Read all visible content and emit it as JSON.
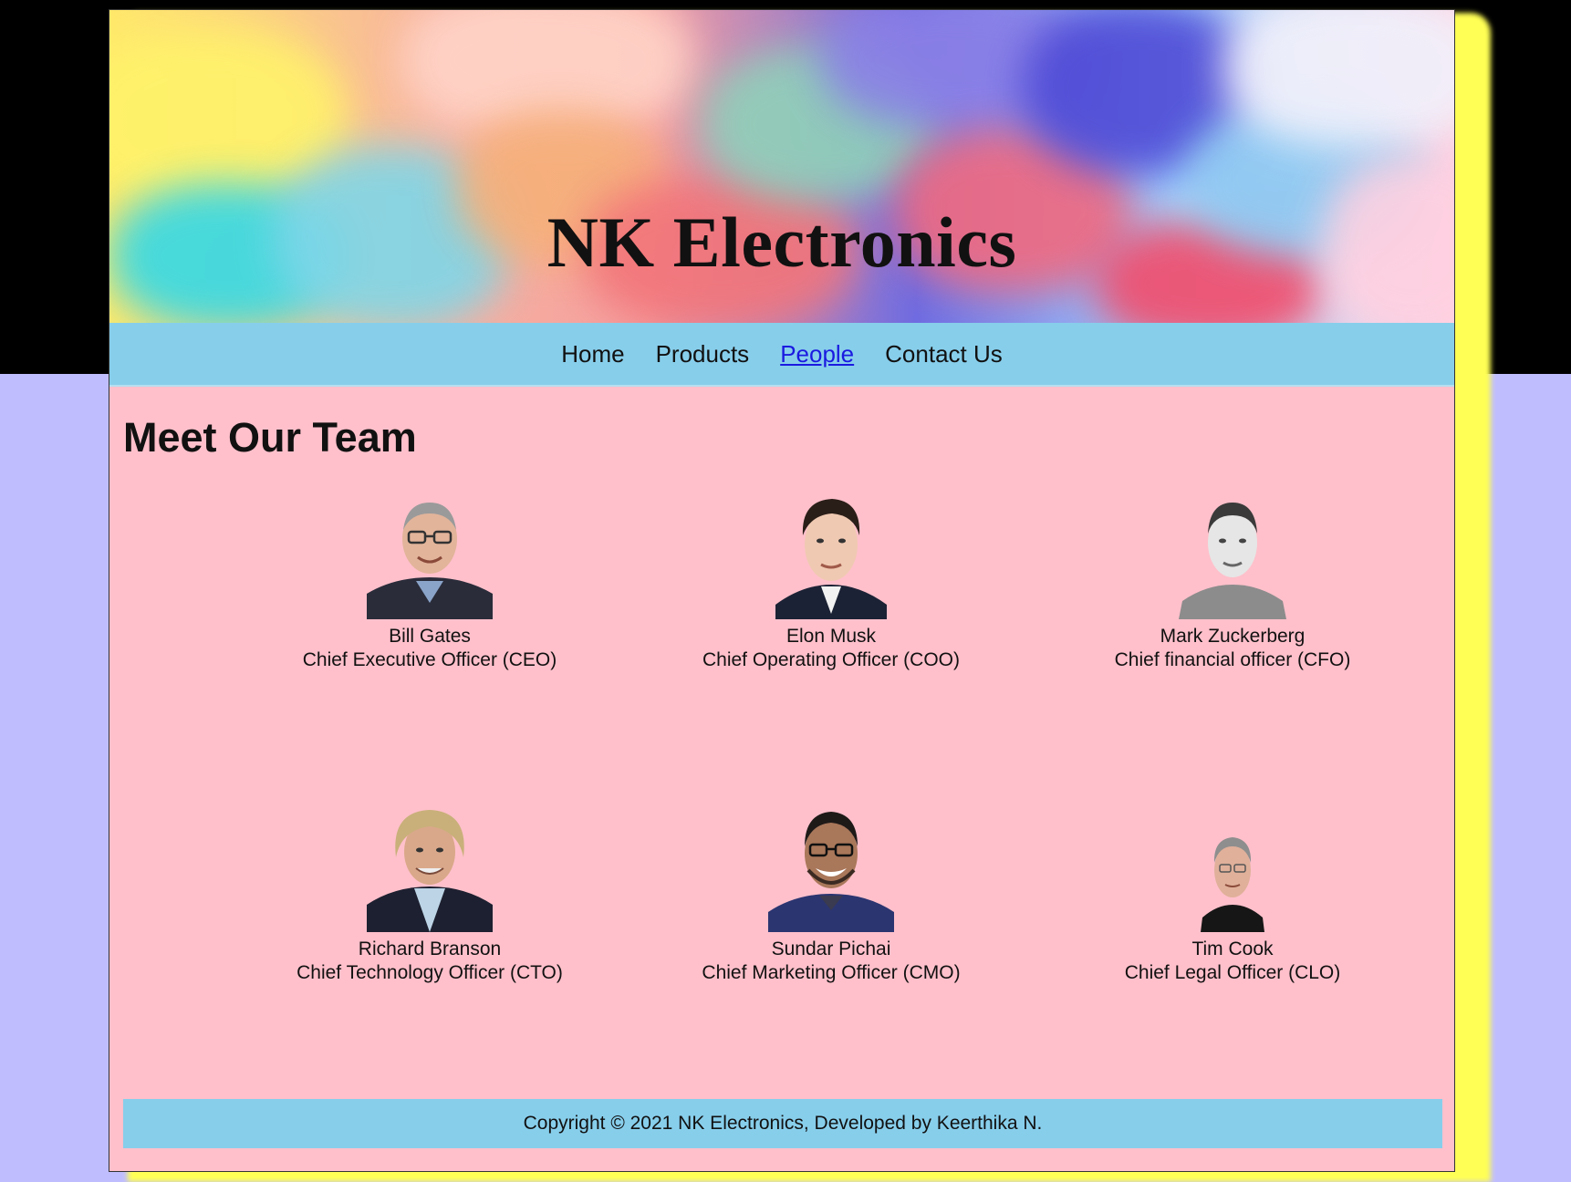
{
  "site": {
    "title": "NK Electronics"
  },
  "nav": {
    "items": [
      {
        "label": "Home",
        "active": false
      },
      {
        "label": "Products",
        "active": false
      },
      {
        "label": "People",
        "active": true
      },
      {
        "label": "Contact Us",
        "active": false
      }
    ]
  },
  "team": {
    "heading": "Meet Our Team",
    "members": [
      {
        "name": "Bill Gates",
        "role": "Chief Executive Officer (CEO)"
      },
      {
        "name": "Elon Musk",
        "role": "Chief Operating Officer (COO)"
      },
      {
        "name": "Mark Zuckerberg",
        "role": "Chief financial officer (CFO)"
      },
      {
        "name": "Richard Branson",
        "role": "Chief Technology Officer (CTO)"
      },
      {
        "name": "Sundar Pichai",
        "role": "Chief Marketing Officer (CMO)"
      },
      {
        "name": "Tim Cook",
        "role": "Chief Legal Officer (CLO)"
      }
    ]
  },
  "footer": {
    "text": "Copyright © 2021 NK Electronics, Developed by Keerthika N."
  },
  "colors": {
    "nav_bg": "#87ceeb",
    "content_bg": "#ffc0cb",
    "active_link": "#1a1ae0",
    "page_outer_bg": "#c0bdff"
  }
}
